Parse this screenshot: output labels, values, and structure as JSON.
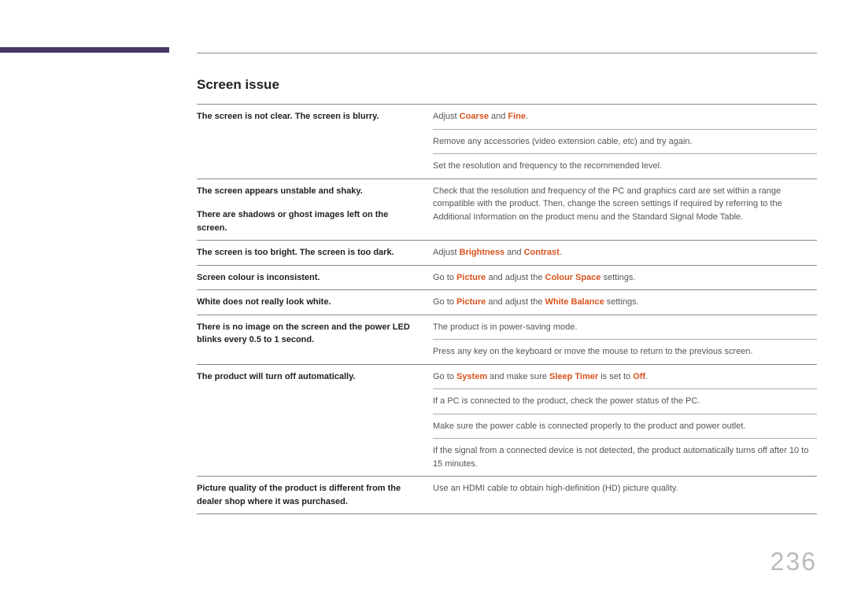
{
  "section_title": "Screen issue",
  "page_number": "236",
  "rows": [
    {
      "left": "The screen is not clear. The screen is blurry.",
      "rights": [
        {
          "segs": [
            {
              "t": "Adjust "
            },
            {
              "t": "Coarse",
              "hl": true
            },
            {
              "t": " and "
            },
            {
              "t": "Fine",
              "hl": true
            },
            {
              "t": "."
            }
          ]
        },
        {
          "segs": [
            {
              "t": "Remove any accessories (video extension cable, etc) and try again."
            }
          ]
        },
        {
          "segs": [
            {
              "t": "Set the resolution and frequency to the recommended level."
            }
          ]
        }
      ]
    },
    {
      "left": "The screen appears unstable and shaky.",
      "left2": "There are shadows or ghost images left on the screen.",
      "rights": [
        {
          "segs": [
            {
              "t": "Check that the resolution and frequency of the PC and graphics card are set within a range compatible with the product. Then, change the screen settings if required by referring to the Additional Information on the product menu and the Standard Signal Mode Table."
            }
          ]
        }
      ]
    },
    {
      "left": "The screen is too bright. The screen is too dark.",
      "rights": [
        {
          "segs": [
            {
              "t": "Adjust "
            },
            {
              "t": "Brightness",
              "hl": true
            },
            {
              "t": " and "
            },
            {
              "t": "Contrast",
              "hl": true
            },
            {
              "t": "."
            }
          ]
        }
      ]
    },
    {
      "left": "Screen colour is inconsistent.",
      "rights": [
        {
          "segs": [
            {
              "t": "Go to "
            },
            {
              "t": "Picture",
              "hl": true
            },
            {
              "t": " and adjust the "
            },
            {
              "t": "Colour Space",
              "hl": true
            },
            {
              "t": " settings."
            }
          ]
        }
      ]
    },
    {
      "left": "White does not really look white.",
      "rights": [
        {
          "segs": [
            {
              "t": "Go to "
            },
            {
              "t": "Picture",
              "hl": true
            },
            {
              "t": " and adjust the "
            },
            {
              "t": "White Balance",
              "hl": true
            },
            {
              "t": " settings."
            }
          ]
        }
      ]
    },
    {
      "left": "There is no image on the screen and the power LED blinks every 0.5 to 1 second.",
      "rights": [
        {
          "segs": [
            {
              "t": "The product is in power-saving mode."
            }
          ]
        },
        {
          "segs": [
            {
              "t": "Press any key on the keyboard or move the mouse to return to the previous screen."
            }
          ]
        }
      ]
    },
    {
      "left": "The product will turn off automatically.",
      "rights": [
        {
          "segs": [
            {
              "t": "Go to "
            },
            {
              "t": "System",
              "hl": true
            },
            {
              "t": " and make sure "
            },
            {
              "t": "Sleep Timer",
              "hl": true
            },
            {
              "t": " is set to "
            },
            {
              "t": "Off",
              "hl": true
            },
            {
              "t": "."
            }
          ]
        },
        {
          "segs": [
            {
              "t": "If a PC is connected to the product, check the power status of the PC."
            }
          ]
        },
        {
          "segs": [
            {
              "t": "Make sure the power cable is connected properly to the product and power outlet."
            }
          ]
        },
        {
          "segs": [
            {
              "t": "If the signal from a connected device is not detected, the product automatically turns off after 10 to 15 minutes."
            }
          ]
        }
      ]
    },
    {
      "left": "Picture quality of the product is different from the dealer shop where it was purchased.",
      "rights": [
        {
          "segs": [
            {
              "t": "Use an HDMI cable to obtain high-definition (HD) picture quality."
            }
          ]
        }
      ],
      "bottom_border": true
    }
  ]
}
